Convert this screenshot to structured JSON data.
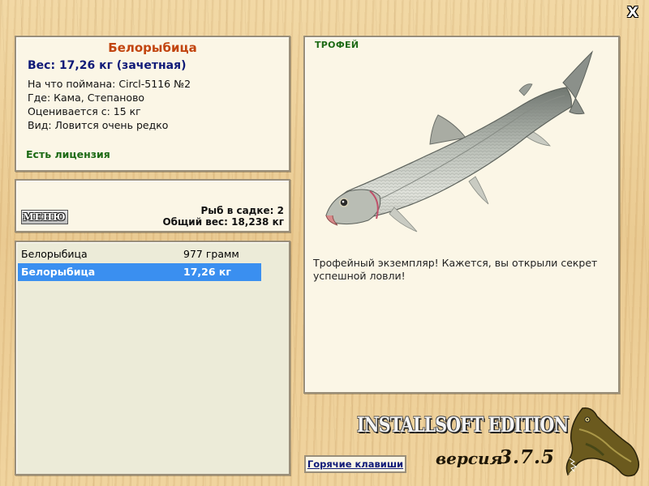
{
  "close_label": "X",
  "info": {
    "fish_name": "Белорыбица",
    "weight_line": "Вес: 17,26 кг (зачетная)",
    "attributes": [
      "На что поймана: Circl-5116 №2",
      "Где: Кама, Степаново",
      "Оценивается с: 15 кг",
      "Вид: Ловится очень редко"
    ],
    "license": "Есть лицензия"
  },
  "keepnet": {
    "menu_label": "МЕНЮ",
    "count_line": "Рыб в садке: 2",
    "total_line": "Общий вес: 18,238 кг"
  },
  "catch_list": [
    {
      "name": "Белорыбица",
      "weight": "977 грамм",
      "selected": false
    },
    {
      "name": "Белорыбица",
      "weight": "17,26 кг",
      "selected": true
    }
  ],
  "trophy": {
    "label": "ТРОФЕЙ",
    "text": "Трофейный экземпляр! Кажется, вы открыли секрет успешной ловли!"
  },
  "footer": {
    "edition": "INSTALLSOFT EDITION",
    "version_label": "версия",
    "version_number": "3.7.5",
    "hotkeys_label": "Горячие клавиши"
  },
  "colors": {
    "fish_name": "#c2450f",
    "weight": "#0f1a78",
    "license": "#1c6a14",
    "selection": "#3a8ff0"
  },
  "icons": [
    "close-icon",
    "whitefish-illustration",
    "pike-logo-icon"
  ]
}
